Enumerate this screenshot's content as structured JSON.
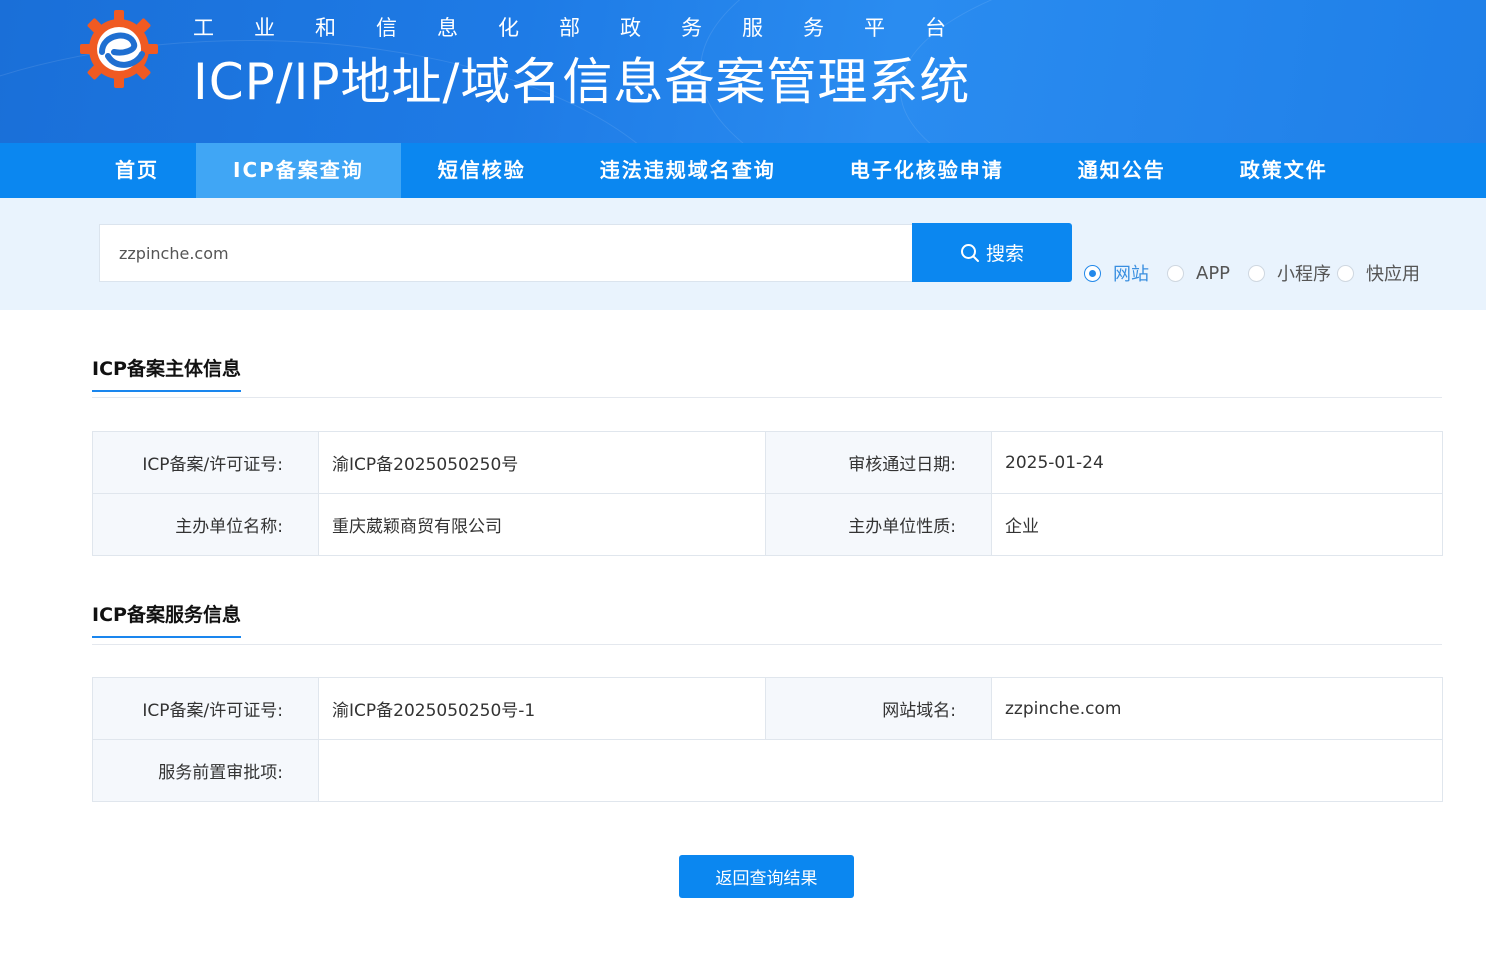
{
  "header": {
    "tagline": "工业和信息化部政务服务平台",
    "title": "ICP/IP地址/域名信息备案管理系统"
  },
  "nav": {
    "items": [
      {
        "label": "首页"
      },
      {
        "label": "ICP备案查询"
      },
      {
        "label": "短信核验"
      },
      {
        "label": "违法违规域名查询"
      },
      {
        "label": "电子化核验申请"
      },
      {
        "label": "通知公告"
      },
      {
        "label": "政策文件"
      }
    ],
    "active": "ICP备案查询"
  },
  "search": {
    "value": "zzpinche.com",
    "button_label": "搜索",
    "types": [
      {
        "label": "网站",
        "checked": true
      },
      {
        "label": "APP",
        "checked": false
      },
      {
        "label": "小程序",
        "checked": false
      },
      {
        "label": "快应用",
        "checked": false
      }
    ]
  },
  "subject": {
    "title": "ICP备案主体信息",
    "license_label": "ICP备案/许可证号:",
    "license_value": "渝ICP备2025050250号",
    "approve_date_label": "审核通过日期:",
    "approve_date_value": "2025-01-24",
    "org_name_label": "主办单位名称:",
    "org_name_value": "重庆葳颖商贸有限公司",
    "org_type_label": "主办单位性质:",
    "org_type_value": "企业"
  },
  "service": {
    "title": "ICP备案服务信息",
    "license_label": "ICP备案/许可证号:",
    "license_value": "渝ICP备2025050250号-1",
    "domain_label": "网站域名:",
    "domain_value": "zzpinche.com",
    "pre_approval_label": "服务前置审批项:",
    "pre_approval_value": ""
  },
  "back_button": "返回查询结果",
  "colors": {
    "primary": "#0b87f0",
    "nav_active": "#40a6f5",
    "search_band": "#e9f3fd"
  }
}
